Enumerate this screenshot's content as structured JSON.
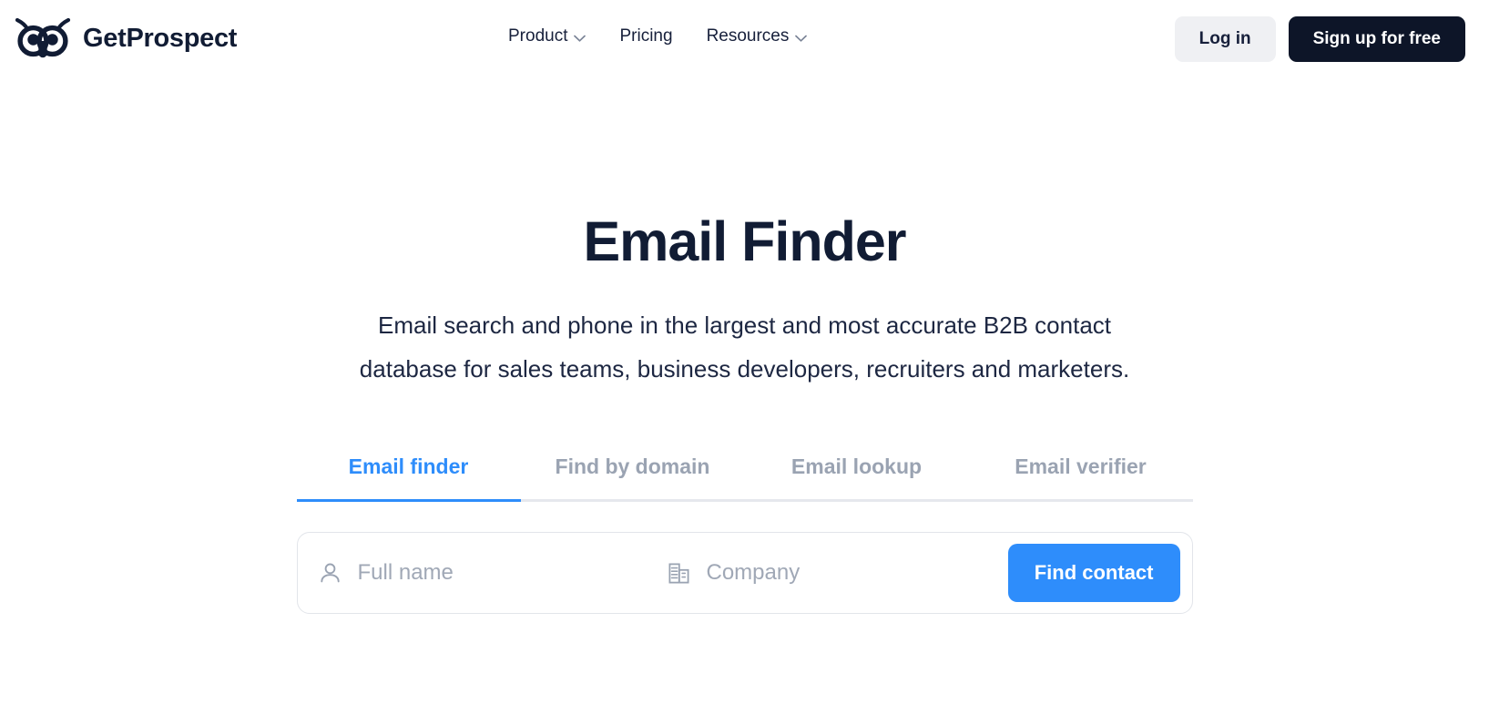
{
  "header": {
    "brand": {
      "name": "GetProspect",
      "logo_icon": "owl-logo-icon"
    },
    "nav": [
      {
        "label": "Product",
        "has_dropdown": true,
        "icon": "chevron-down-icon"
      },
      {
        "label": "Pricing",
        "has_dropdown": false,
        "icon": ""
      },
      {
        "label": "Resources",
        "has_dropdown": true,
        "icon": "chevron-down-icon"
      }
    ],
    "actions": {
      "login_label": "Log in",
      "signup_label": "Sign up for free"
    }
  },
  "hero": {
    "title": "Email Finder",
    "subtitle": "Email search and phone in the largest and most accurate B2B contact database for sales teams, business developers, recruiters and marketers."
  },
  "tabs": [
    {
      "label": "Email finder",
      "active": true
    },
    {
      "label": "Find by domain",
      "active": false
    },
    {
      "label": "Email lookup",
      "active": false
    },
    {
      "label": "Email verifier",
      "active": false
    }
  ],
  "search": {
    "name_field": {
      "placeholder": "Full name",
      "value": "",
      "icon": "person-icon"
    },
    "company_field": {
      "placeholder": "Company",
      "value": "",
      "icon": "building-icon"
    },
    "submit_label": "Find contact"
  },
  "colors": {
    "accent_blue": "#2e8dfb",
    "dark_navy": "#0d1528",
    "text_dark": "#111c34",
    "muted_gray": "#9aa3b2",
    "light_gray_bg": "#eff0f3",
    "border": "#e2e5ea"
  }
}
